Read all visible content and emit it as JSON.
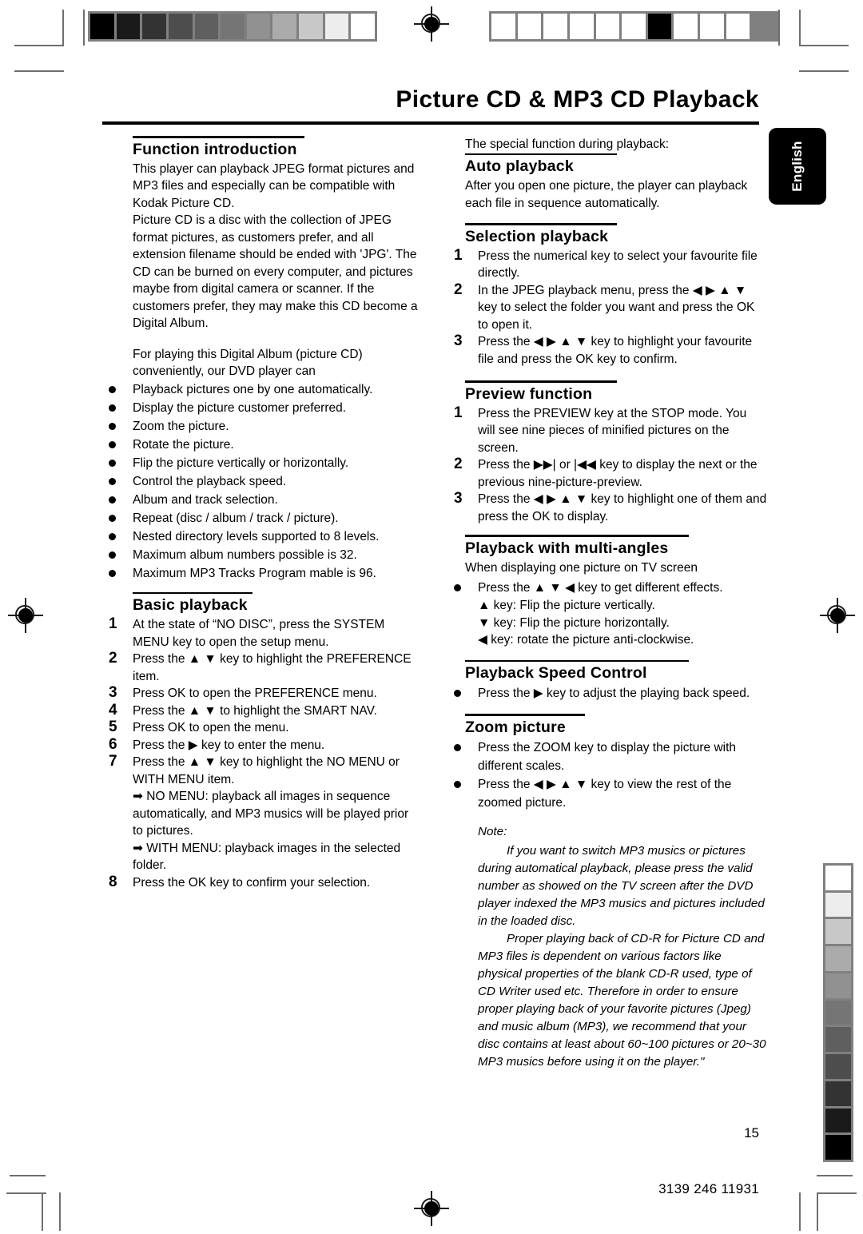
{
  "document": {
    "title": "Picture CD & MP3 CD Playback",
    "language_tab": "English",
    "page_number": "15",
    "doc_code": "3139 246 11931"
  },
  "left_column": {
    "function_introduction": {
      "heading": "Function introduction",
      "paragraph_1": "This player can playback JPEG format pictures and MP3 files and especially can be compatible with Kodak Picture CD.",
      "paragraph_2": "Picture CD is a disc with the collection of JPEG format pictures, as customers prefer, and all extension filename should be ended with 'JPG'. The CD can be burned on every computer, and pictures maybe from digital camera or scanner. If the customers prefer, they may make this CD become a Digital Album.",
      "paragraph_3": "For playing this Digital Album (picture CD) conveniently, our DVD player can",
      "features": [
        "Playback pictures one by one automatically.",
        "Display the picture customer preferred.",
        "Zoom the picture.",
        "Rotate the picture.",
        "Flip the picture vertically or horizontally.",
        "Control the playback speed.",
        "Album and track selection.",
        "Repeat (disc / album / track / picture).",
        "Nested directory levels supported to 8 levels.",
        "Maximum album numbers possible is 32.",
        "Maximum MP3 Tracks Program mable is 96."
      ]
    },
    "basic_playback": {
      "heading": "Basic playback",
      "steps": [
        {
          "num": "1",
          "text": "At the state of “NO DISC”, press the SYSTEM MENU key to open the setup menu."
        },
        {
          "num": "2",
          "text": "Press the ▲ ▼ key to highlight the PREFERENCE item."
        },
        {
          "num": "3",
          "text": "Press OK to open the PREFERENCE menu."
        },
        {
          "num": "4",
          "text": "Press the ▲ ▼ to highlight the SMART NAV."
        },
        {
          "num": "5",
          "text": "Press OK to open the menu."
        },
        {
          "num": "6",
          "text": "Press the ▶ key to enter the menu."
        },
        {
          "num": "7",
          "text": "Press the ▲ ▼ key to highlight the NO MENU or WITH MENU item.",
          "subs": [
            "➡ NO MENU: playback all images in sequence automatically, and MP3 musics will be played prior to pictures.",
            "➡ WITH MENU: playback images in the selected folder."
          ]
        },
        {
          "num": "8",
          "text": "Press the OK key to confirm your selection."
        }
      ]
    }
  },
  "right_column": {
    "intro_line": "The special function during playback:",
    "auto_playback": {
      "heading": "Auto playback",
      "text": "After you open one picture, the player can playback each file in sequence automatically."
    },
    "selection_playback": {
      "heading": "Selection playback",
      "steps": [
        {
          "num": "1",
          "text": "Press the numerical key to select your favourite file directly."
        },
        {
          "num": "2",
          "text": "In the JPEG playback menu, press the ◀ ▶ ▲ ▼ key to select the folder you want and press the OK to open it."
        },
        {
          "num": "3",
          "text": "Press the ◀ ▶ ▲ ▼ key to highlight your favourite file and press the OK key to confirm."
        }
      ]
    },
    "preview_function": {
      "heading": "Preview function",
      "steps": [
        {
          "num": "1",
          "text": "Press the PREVIEW key at the STOP mode. You will see nine pieces of minified pictures on the screen."
        },
        {
          "num": "2",
          "text": "Press the ▶▶| or |◀◀ key to display the next or the previous nine-picture-preview."
        },
        {
          "num": "3",
          "text": "Press the ◀ ▶ ▲ ▼ key to highlight one of them and press the OK to display."
        }
      ]
    },
    "multi_angles": {
      "heading": "Playback with multi-angles",
      "lead": "When displaying one picture on TV screen",
      "bullet": "Press the ▲ ▼ ◀ key to get different effects.",
      "details": [
        "▲ key: Flip the picture vertically.",
        "▼ key: Flip the picture horizontally.",
        "◀ key: rotate the picture anti-clockwise."
      ]
    },
    "speed_control": {
      "heading": "Playback Speed Control",
      "bullet": "Press the ▶ key to adjust the playing back speed."
    },
    "zoom_picture": {
      "heading": "Zoom picture",
      "bullets": [
        "Press the ZOOM key to display the picture with different scales.",
        "Press the ◀ ▶ ▲ ▼ key to view the rest of the zoomed picture."
      ]
    },
    "note": {
      "label": "Note:",
      "paragraph_1": "If you want to switch MP3 musics or pictures during automatical playback, please press the valid number as showed on the TV screen after the DVD player indexed the MP3 musics and pictures included in the loaded disc.",
      "paragraph_2": "Proper playing back of CD-R for Picture CD and MP3 files is dependent on various factors like physical properties of the blank CD-R used, type of CD Writer used etc. Therefore in order to ensure proper playing back of your favorite pictures (Jpeg) and music album (MP3), we recommend that your disc contains at least about 60~100 pictures or 20~30 MP3 musics before using it on the player.\""
    }
  },
  "prepress": {
    "gray_wedge_top_left": [
      "#000000",
      "#1a1a1a",
      "#333333",
      "#4d4d4d",
      "#5f5f5f",
      "#757575",
      "#919191",
      "#ababab",
      "#c8c8c8",
      "#ededed",
      "#ffffff"
    ],
    "color_bar_top_right": [
      "#ffffff",
      "#ffffff",
      "#ffffff",
      "#ffffff",
      "#ffffff",
      "#ffffff",
      "#000000",
      "#ffffff",
      "#ffffff",
      "#ffffff",
      "#808080"
    ],
    "gray_wedge_right": [
      "#ffffff",
      "#ededed",
      "#c8c8c8",
      "#ababab",
      "#919191",
      "#757575",
      "#5f5f5f",
      "#4d4d4d",
      "#333333",
      "#1a1a1a",
      "#000000"
    ]
  }
}
